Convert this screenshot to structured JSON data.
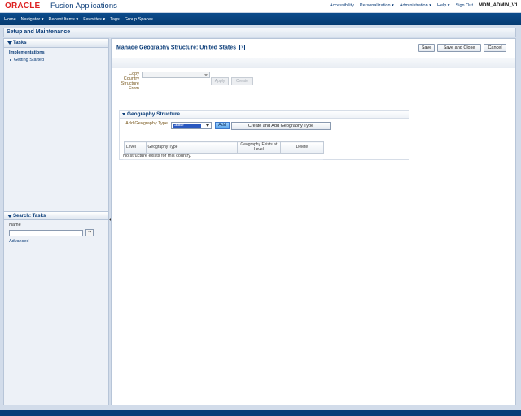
{
  "header": {
    "logo": "ORACLE",
    "product": "Fusion Applications",
    "links": [
      "Accessibility",
      "Personalization ▾",
      "Administration ▾",
      "Help ▾",
      "Sign Out"
    ],
    "user": "MDM_ADMIN_V1"
  },
  "nav": {
    "items": [
      "Home",
      "Navigator ▾",
      "Recent Items ▾",
      "Favorites ▾",
      "Tags",
      "Group Spaces"
    ]
  },
  "page": {
    "title": "Setup and Maintenance"
  },
  "left": {
    "tasks_header": "Tasks",
    "implementations": "Implementations",
    "getting_started": "Getting Started",
    "search_header": "Search: Tasks",
    "name_label": "Name",
    "name_value": "",
    "go_glyph": "➜",
    "advanced": "Advanced"
  },
  "main": {
    "title": "Manage Geography Structure: United States",
    "help_glyph": "?",
    "buttons": {
      "save": "Save",
      "save_close": "Save and Close",
      "cancel": "Cancel"
    },
    "copy": {
      "label": "Copy Country Structure From",
      "value": "",
      "apply": "Apply",
      "create": "Create"
    },
    "geo": {
      "header": "Geography Structure",
      "add_label": "Add Geography Type",
      "selected": "State",
      "add": "Add",
      "create_add": "Create and Add Geography Type",
      "columns": [
        "Level",
        "Geography Type",
        "Geography Exists at Level",
        "Delete"
      ],
      "empty": "No structure exists for this country."
    }
  },
  "colors": {
    "brand_red": "#dd2222",
    "nav_blue": "#0a3c78",
    "selection_blue": "#2a59c0"
  }
}
